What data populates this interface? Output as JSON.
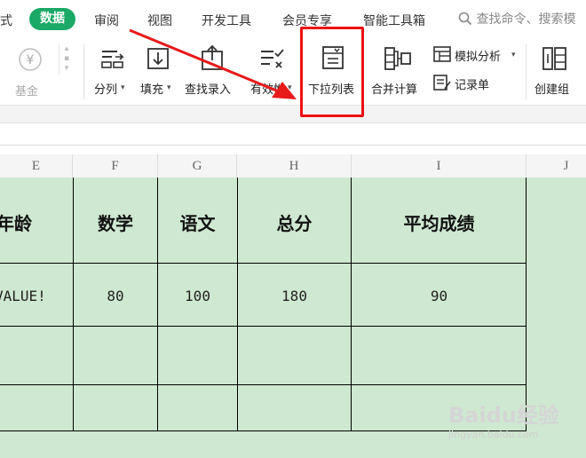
{
  "menubar": {
    "partial_left": "式",
    "active_tab": "数据",
    "tabs": [
      "审阅",
      "视图",
      "开发工具",
      "会员专享",
      "智能工具箱"
    ],
    "search_placeholder": "查找命令、搜索模"
  },
  "ribbon": {
    "fund_label": "基金",
    "split_label": "分列",
    "fill_label": "填充",
    "lookup_entry_label": "查找录入",
    "validity_label": "有效性",
    "dropdown_list_label": "下拉列表",
    "merge_calc_label": "合并计算",
    "simulate_analysis_label": "模拟分析",
    "record_sheet_label": "记录单",
    "create_group_label": "创建组"
  },
  "columns": [
    "E",
    "F",
    "G",
    "H",
    "I",
    "J"
  ],
  "table": {
    "headers": [
      "年龄",
      "数学",
      "语文",
      "总分",
      "平均成绩"
    ],
    "rows": [
      [
        "VALUE!",
        "80",
        "100",
        "180",
        "90"
      ],
      [
        "",
        "",
        "",
        "",
        ""
      ],
      [
        "",
        "",
        "",
        "",
        ""
      ]
    ]
  },
  "colors": {
    "active_tab": "#1aa966",
    "highlight_box": "#e11111",
    "cell_fill": "#cfe8d1"
  },
  "watermark": {
    "brand": "Baidu经验",
    "url": "jingyan.baidu.com"
  }
}
